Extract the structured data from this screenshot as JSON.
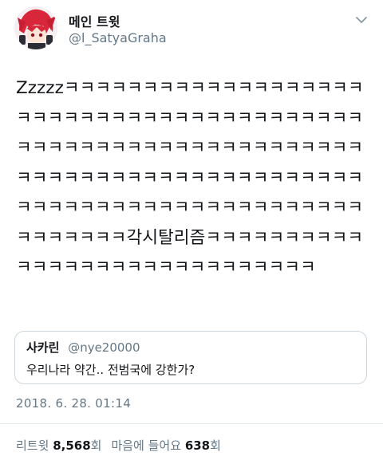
{
  "author": {
    "display_name": "메인 트윗",
    "handle": "@l_SatyaGraha"
  },
  "tweet": {
    "text": "Zzzzzㅋㅋㅋㅋㅋㅋㅋㅋㅋㅋㅋㅋㅋㅋㅋㅋㅋㅋㅋㅋㅋㅋㅋㅋㅋㅋㅋㅋㅋㅋㅋㅋㅋㅋㅋㅋㅋㅋㅋㅋㅋㅋㅋㅋㅋㅋㅋㅋㅋㅋㅋㅋㅋㅋㅋㅋㅋㅋㅋㅋㅋㅋㅋㅋㅋㅋㅋㅋㅋㅋㅋㅋㅋㅋㅋㅋㅋㅋㅋㅋㅋㅋㅋㅋㅋㅋㅋㅋㅋㅋㅋㅋㅋㅋㅋㅋㅋㅋㅋㅋㅋㅋㅋㅋㅋㅋㅋㅋㅋㅋㅋㅋㅋㅋ각시탈리즘ㅋㅋㅋㅋㅋㅋㅋㅋㅋㅋㅋㅋㅋㅋㅋㅋㅋㅋㅋㅋㅋㅋㅋㅋㅋㅋㅋㅋㅋ",
    "timestamp": "2018. 6. 28. 01:14"
  },
  "quote": {
    "name": "사카린",
    "handle": "@nye20000",
    "text": "우리나라 약간.. 전범국에 강한가?"
  },
  "stats": {
    "retweets_label": "리트윗",
    "retweets_count": "8,568",
    "retweets_unit": "회",
    "likes_label": "마음에 들어요",
    "likes_count": "638",
    "likes_unit": "회"
  },
  "icons": {
    "menu": "chevron-down-icon"
  },
  "colors": {
    "text": "#14171a",
    "secondary_text": "#657786",
    "border": "#ccd6dd"
  }
}
